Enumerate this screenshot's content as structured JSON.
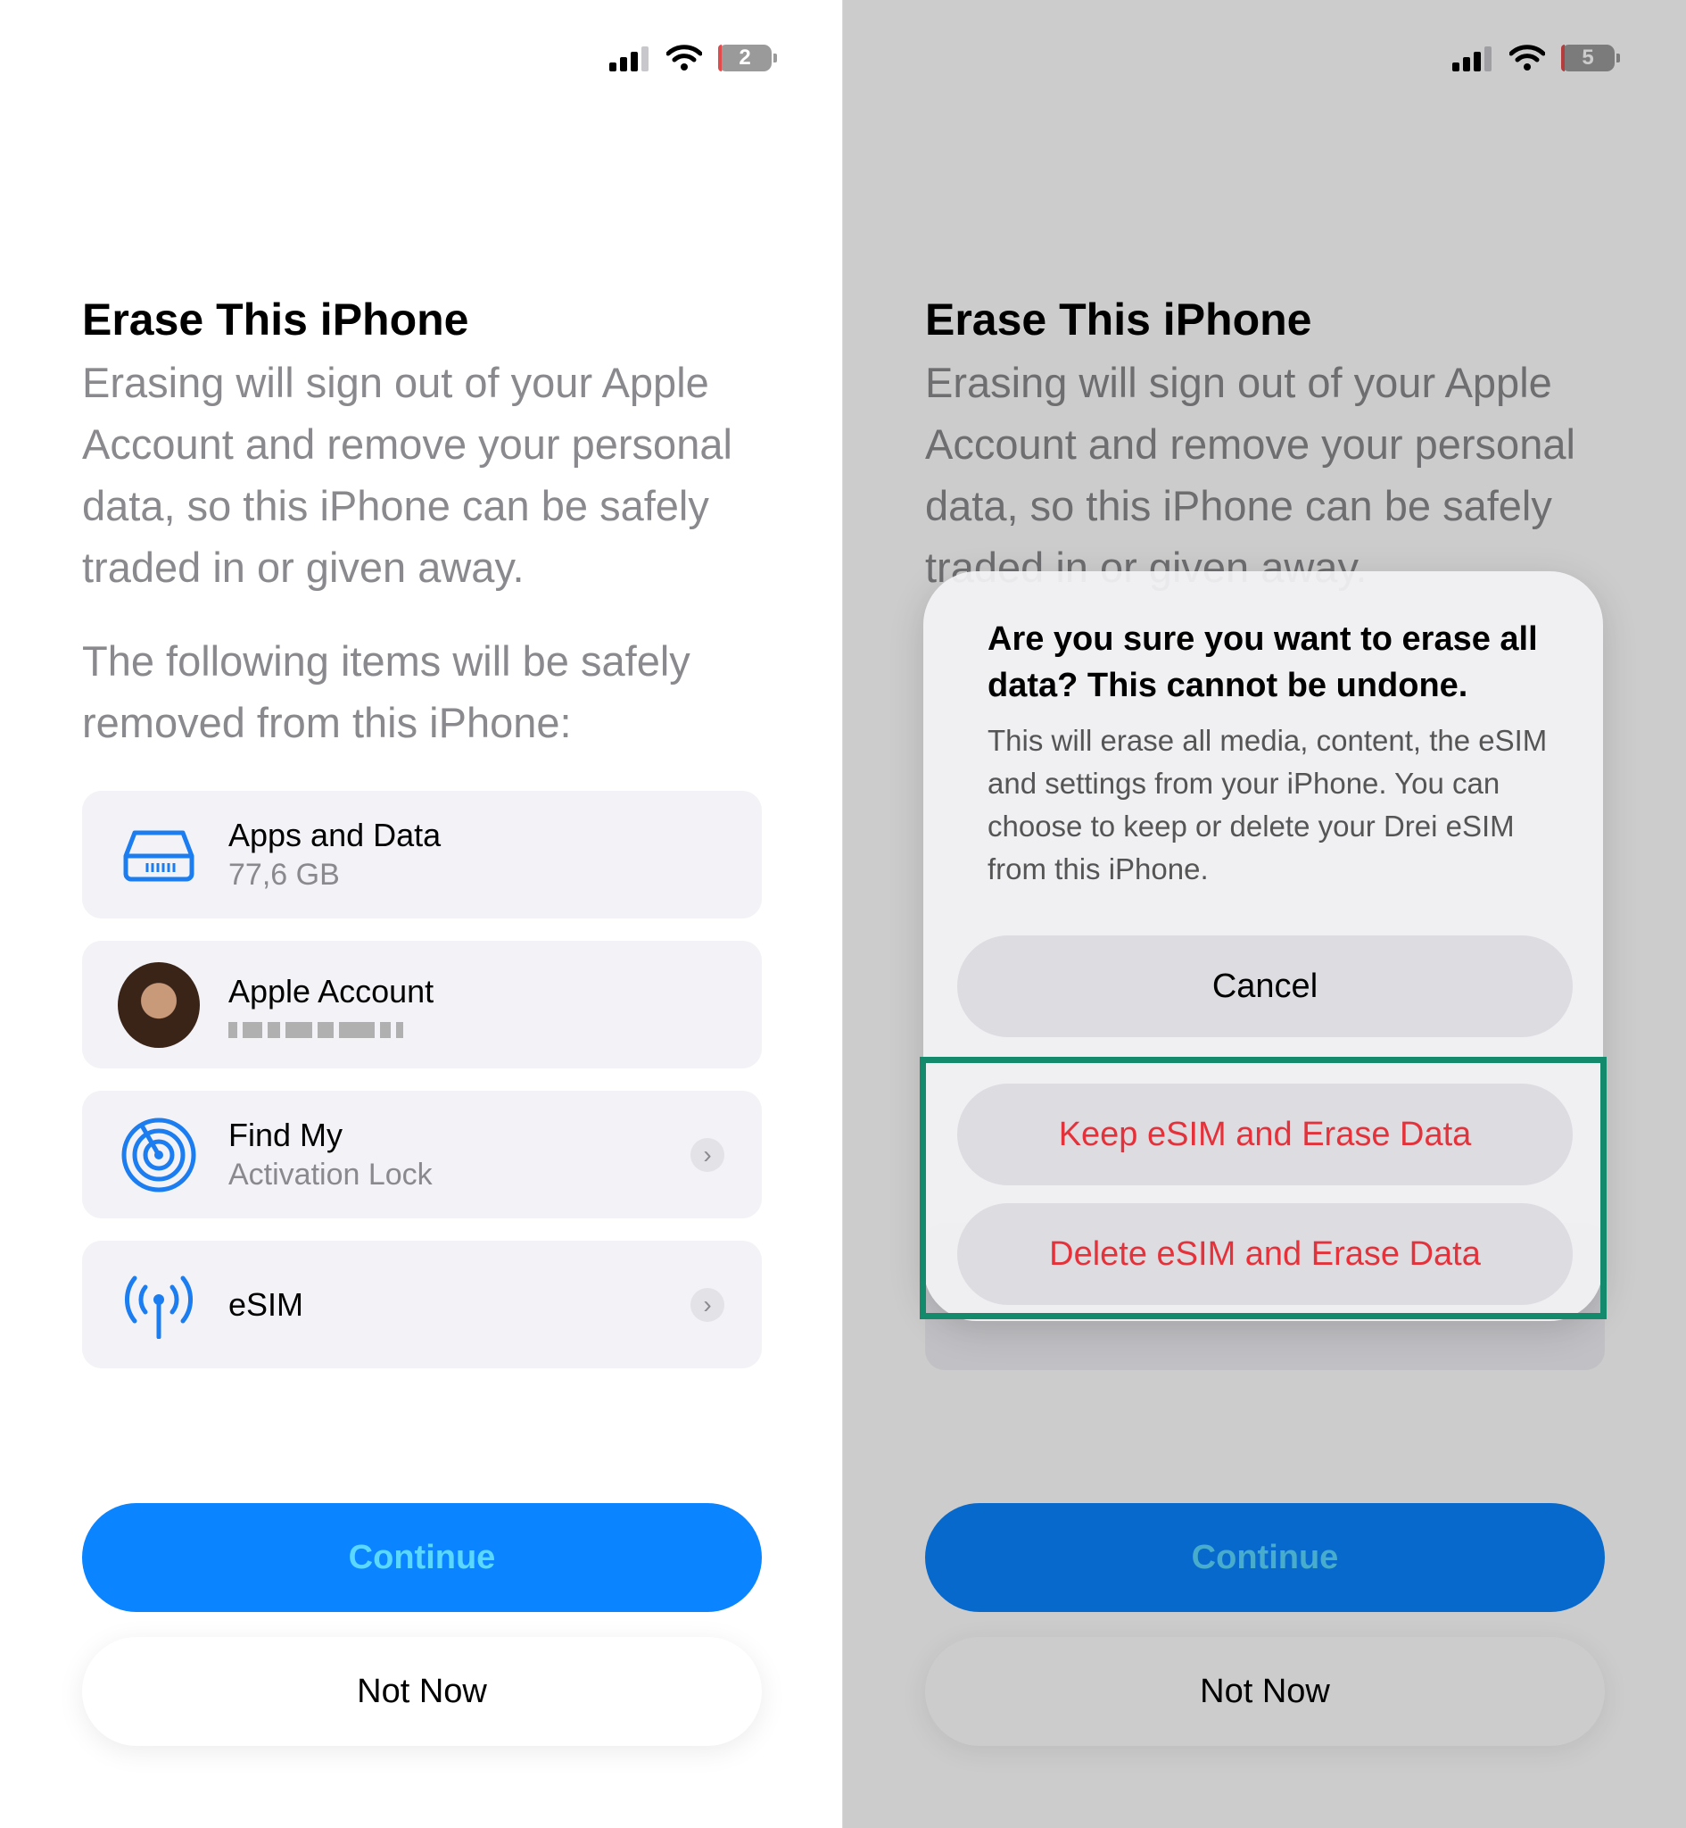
{
  "left": {
    "battery": "2",
    "title": "Erase This iPhone",
    "description": "Erasing will sign out of your Apple Account and remove your personal data, so this iPhone can be safely traded in or given away.",
    "items_intro": "The following items will be safely removed from this iPhone:",
    "items": [
      {
        "label": "Apps and Data",
        "sub": "77,6 GB",
        "icon": "drive-icon"
      },
      {
        "label": "Apple Account",
        "sub": "",
        "icon": "avatar"
      },
      {
        "label": "Find My",
        "sub": "Activation Lock",
        "icon": "find-my-icon"
      },
      {
        "label": "eSIM",
        "sub": "",
        "icon": "antenna-icon"
      }
    ],
    "continue_label": "Continue",
    "not_now_label": "Not Now"
  },
  "right": {
    "battery": "5",
    "title": "Erase This iPhone",
    "description": "Erasing will sign out of your Apple Account and remove your personal data, so this iPhone can be safely traded in or given away.",
    "continue_label": "Continue",
    "not_now_label": "Not Now",
    "alert": {
      "title": "Are you sure you want to erase all data? This cannot be undone.",
      "message": "This will erase all media, content, the eSIM and settings from your iPhone. You can choose to keep or delete your Drei eSIM from this iPhone.",
      "cancel_label": "Cancel",
      "keep_label": "Keep eSIM and Erase Data",
      "delete_label": "Delete eSIM and Erase Data"
    }
  },
  "colors": {
    "accent": "#0a84ff",
    "destructive": "#e5323a",
    "highlight": "#148a6c"
  }
}
